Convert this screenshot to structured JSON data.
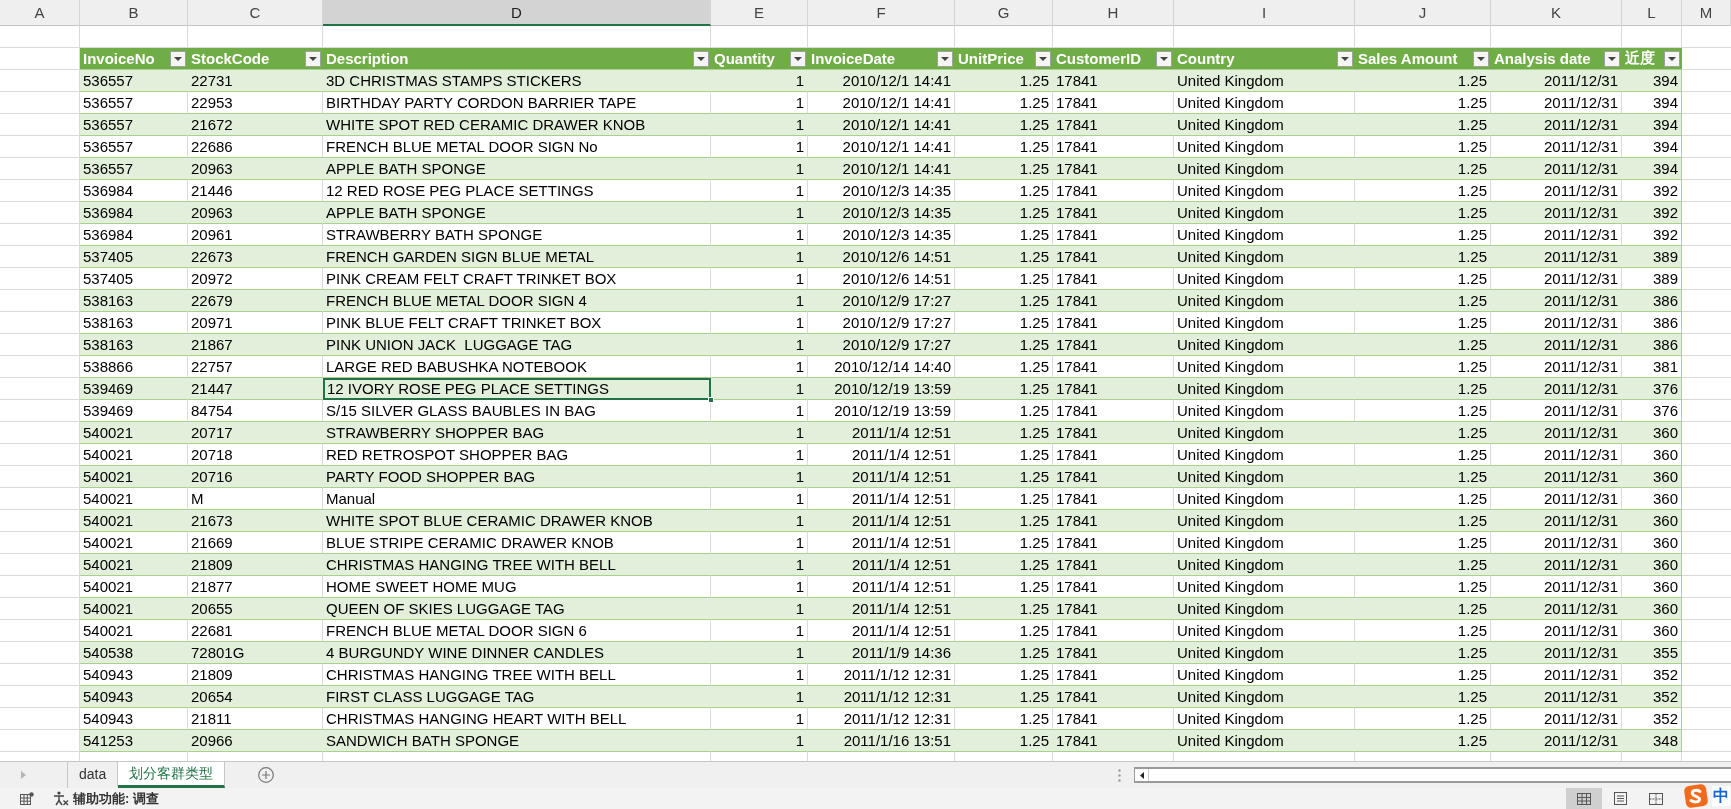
{
  "column_letters": [
    {
      "label": "A",
      "selected": false
    },
    {
      "label": "B",
      "selected": false
    },
    {
      "label": "C",
      "selected": false
    },
    {
      "label": "D",
      "selected": true
    },
    {
      "label": "E",
      "selected": false
    },
    {
      "label": "F",
      "selected": false
    },
    {
      "label": "G",
      "selected": false
    },
    {
      "label": "H",
      "selected": false
    },
    {
      "label": "I",
      "selected": false
    },
    {
      "label": "J",
      "selected": false
    },
    {
      "label": "K",
      "selected": false
    },
    {
      "label": "L",
      "selected": false
    },
    {
      "label": "M",
      "selected": false
    }
  ],
  "table": {
    "columns": [
      {
        "label": "InvoiceNo",
        "kind": "text"
      },
      {
        "label": "StockCode",
        "kind": "text"
      },
      {
        "label": "Description",
        "kind": "text"
      },
      {
        "label": "Quantity",
        "kind": "number"
      },
      {
        "label": "InvoiceDate",
        "kind": "number"
      },
      {
        "label": "UnitPrice",
        "kind": "number"
      },
      {
        "label": "CustomerID",
        "kind": "text"
      },
      {
        "label": "Country",
        "kind": "text"
      },
      {
        "label": "Sales Amount",
        "kind": "number"
      },
      {
        "label": "Analysis date",
        "kind": "number"
      },
      {
        "label": "近度",
        "kind": "number"
      }
    ],
    "rows": [
      {
        "cells": [
          "536557",
          "22731",
          "3D CHRISTMAS STAMPS STICKERS",
          "1",
          "2010/12/1 14:41",
          "1.25",
          "17841",
          "United Kingdom",
          "1.25",
          "2011/12/31",
          "394"
        ],
        "selected": false
      },
      {
        "cells": [
          "536557",
          "22953",
          "BIRTHDAY PARTY CORDON BARRIER TAPE",
          "1",
          "2010/12/1 14:41",
          "1.25",
          "17841",
          "United Kingdom",
          "1.25",
          "2011/12/31",
          "394"
        ],
        "selected": false
      },
      {
        "cells": [
          "536557",
          "21672",
          "WHITE SPOT RED CERAMIC DRAWER KNOB",
          "1",
          "2010/12/1 14:41",
          "1.25",
          "17841",
          "United Kingdom",
          "1.25",
          "2011/12/31",
          "394"
        ],
        "selected": false
      },
      {
        "cells": [
          "536557",
          "22686",
          "FRENCH BLUE METAL DOOR SIGN No",
          "1",
          "2010/12/1 14:41",
          "1.25",
          "17841",
          "United Kingdom",
          "1.25",
          "2011/12/31",
          "394"
        ],
        "selected": false
      },
      {
        "cells": [
          "536557",
          "20963",
          "APPLE BATH SPONGE",
          "1",
          "2010/12/1 14:41",
          "1.25",
          "17841",
          "United Kingdom",
          "1.25",
          "2011/12/31",
          "394"
        ],
        "selected": false
      },
      {
        "cells": [
          "536984",
          "21446",
          "12 RED ROSE PEG PLACE SETTINGS",
          "1",
          "2010/12/3 14:35",
          "1.25",
          "17841",
          "United Kingdom",
          "1.25",
          "2011/12/31",
          "392"
        ],
        "selected": false
      },
      {
        "cells": [
          "536984",
          "20963",
          "APPLE BATH SPONGE",
          "1",
          "2010/12/3 14:35",
          "1.25",
          "17841",
          "United Kingdom",
          "1.25",
          "2011/12/31",
          "392"
        ],
        "selected": false
      },
      {
        "cells": [
          "536984",
          "20961",
          "STRAWBERRY BATH SPONGE",
          "1",
          "2010/12/3 14:35",
          "1.25",
          "17841",
          "United Kingdom",
          "1.25",
          "2011/12/31",
          "392"
        ],
        "selected": false
      },
      {
        "cells": [
          "537405",
          "22673",
          "FRENCH GARDEN SIGN BLUE METAL",
          "1",
          "2010/12/6 14:51",
          "1.25",
          "17841",
          "United Kingdom",
          "1.25",
          "2011/12/31",
          "389"
        ],
        "selected": false
      },
      {
        "cells": [
          "537405",
          "20972",
          "PINK CREAM FELT CRAFT TRINKET BOX",
          "1",
          "2010/12/6 14:51",
          "1.25",
          "17841",
          "United Kingdom",
          "1.25",
          "2011/12/31",
          "389"
        ],
        "selected": false
      },
      {
        "cells": [
          "538163",
          "22679",
          "FRENCH BLUE METAL DOOR SIGN 4",
          "1",
          "2010/12/9 17:27",
          "1.25",
          "17841",
          "United Kingdom",
          "1.25",
          "2011/12/31",
          "386"
        ],
        "selected": false
      },
      {
        "cells": [
          "538163",
          "20971",
          "PINK BLUE FELT CRAFT TRINKET BOX",
          "1",
          "2010/12/9 17:27",
          "1.25",
          "17841",
          "United Kingdom",
          "1.25",
          "2011/12/31",
          "386"
        ],
        "selected": false
      },
      {
        "cells": [
          "538163",
          "21867",
          "PINK UNION JACK  LUGGAGE TAG",
          "1",
          "2010/12/9 17:27",
          "1.25",
          "17841",
          "United Kingdom",
          "1.25",
          "2011/12/31",
          "386"
        ],
        "selected": false
      },
      {
        "cells": [
          "538866",
          "22757",
          "LARGE RED BABUSHKA NOTEBOOK",
          "1",
          "2010/12/14 14:40",
          "1.25",
          "17841",
          "United Kingdom",
          "1.25",
          "2011/12/31",
          "381"
        ],
        "selected": false
      },
      {
        "cells": [
          "539469",
          "21447",
          "12 IVORY ROSE PEG PLACE SETTINGS",
          "1",
          "2010/12/19 13:59",
          "1.25",
          "17841",
          "United Kingdom",
          "1.25",
          "2011/12/31",
          "376"
        ],
        "selected": true
      },
      {
        "cells": [
          "539469",
          "84754",
          "S/15 SILVER GLASS BAUBLES IN BAG",
          "1",
          "2010/12/19 13:59",
          "1.25",
          "17841",
          "United Kingdom",
          "1.25",
          "2011/12/31",
          "376"
        ],
        "selected": false
      },
      {
        "cells": [
          "540021",
          "20717",
          "STRAWBERRY SHOPPER BAG",
          "1",
          "2011/1/4 12:51",
          "1.25",
          "17841",
          "United Kingdom",
          "1.25",
          "2011/12/31",
          "360"
        ],
        "selected": false
      },
      {
        "cells": [
          "540021",
          "20718",
          "RED RETROSPOT SHOPPER BAG",
          "1",
          "2011/1/4 12:51",
          "1.25",
          "17841",
          "United Kingdom",
          "1.25",
          "2011/12/31",
          "360"
        ],
        "selected": false
      },
      {
        "cells": [
          "540021",
          "20716",
          "PARTY FOOD SHOPPER BAG",
          "1",
          "2011/1/4 12:51",
          "1.25",
          "17841",
          "United Kingdom",
          "1.25",
          "2011/12/31",
          "360"
        ],
        "selected": false
      },
      {
        "cells": [
          "540021",
          "M",
          "Manual",
          "1",
          "2011/1/4 12:51",
          "1.25",
          "17841",
          "United Kingdom",
          "1.25",
          "2011/12/31",
          "360"
        ],
        "selected": false
      },
      {
        "cells": [
          "540021",
          "21673",
          "WHITE SPOT BLUE CERAMIC DRAWER KNOB",
          "1",
          "2011/1/4 12:51",
          "1.25",
          "17841",
          "United Kingdom",
          "1.25",
          "2011/12/31",
          "360"
        ],
        "selected": false
      },
      {
        "cells": [
          "540021",
          "21669",
          "BLUE STRIPE CERAMIC DRAWER KNOB",
          "1",
          "2011/1/4 12:51",
          "1.25",
          "17841",
          "United Kingdom",
          "1.25",
          "2011/12/31",
          "360"
        ],
        "selected": false
      },
      {
        "cells": [
          "540021",
          "21809",
          "CHRISTMAS HANGING TREE WITH BELL",
          "1",
          "2011/1/4 12:51",
          "1.25",
          "17841",
          "United Kingdom",
          "1.25",
          "2011/12/31",
          "360"
        ],
        "selected": false
      },
      {
        "cells": [
          "540021",
          "21877",
          "HOME SWEET HOME MUG",
          "1",
          "2011/1/4 12:51",
          "1.25",
          "17841",
          "United Kingdom",
          "1.25",
          "2011/12/31",
          "360"
        ],
        "selected": false
      },
      {
        "cells": [
          "540021",
          "20655",
          "QUEEN OF SKIES LUGGAGE TAG",
          "1",
          "2011/1/4 12:51",
          "1.25",
          "17841",
          "United Kingdom",
          "1.25",
          "2011/12/31",
          "360"
        ],
        "selected": false
      },
      {
        "cells": [
          "540021",
          "22681",
          "FRENCH BLUE METAL DOOR SIGN 6",
          "1",
          "2011/1/4 12:51",
          "1.25",
          "17841",
          "United Kingdom",
          "1.25",
          "2011/12/31",
          "360"
        ],
        "selected": false
      },
      {
        "cells": [
          "540538",
          "72801G",
          "4 BURGUNDY WINE DINNER CANDLES",
          "1",
          "2011/1/9 14:36",
          "1.25",
          "17841",
          "United Kingdom",
          "1.25",
          "2011/12/31",
          "355"
        ],
        "selected": false
      },
      {
        "cells": [
          "540943",
          "21809",
          "CHRISTMAS HANGING TREE WITH BELL",
          "1",
          "2011/1/12 12:31",
          "1.25",
          "17841",
          "United Kingdom",
          "1.25",
          "2011/12/31",
          "352"
        ],
        "selected": false
      },
      {
        "cells": [
          "540943",
          "20654",
          "FIRST CLASS LUGGAGE TAG",
          "1",
          "2011/1/12 12:31",
          "1.25",
          "17841",
          "United Kingdom",
          "1.25",
          "2011/12/31",
          "352"
        ],
        "selected": false
      },
      {
        "cells": [
          "540943",
          "21811",
          "CHRISTMAS HANGING HEART WITH BELL",
          "1",
          "2011/1/12 12:31",
          "1.25",
          "17841",
          "United Kingdom",
          "1.25",
          "2011/12/31",
          "352"
        ],
        "selected": false
      },
      {
        "cells": [
          "541253",
          "20966",
          "SANDWICH BATH SPONGE",
          "1",
          "2011/1/16 13:51",
          "1.25",
          "17841",
          "United Kingdom",
          "1.25",
          "2011/12/31",
          "348"
        ],
        "selected": false
      }
    ]
  },
  "sheet_tabs": [
    {
      "label": "data",
      "selected": false
    },
    {
      "label": "划分客群类型",
      "selected": true
    }
  ],
  "status_bar": {
    "accessibility": "辅助功能: 调查",
    "view_buttons": [
      {
        "kind": "normal",
        "selected": true
      },
      {
        "kind": "page_layout",
        "selected": false
      },
      {
        "kind": "page_break",
        "selected": false
      }
    ]
  },
  "input_method": {
    "label": "中"
  }
}
